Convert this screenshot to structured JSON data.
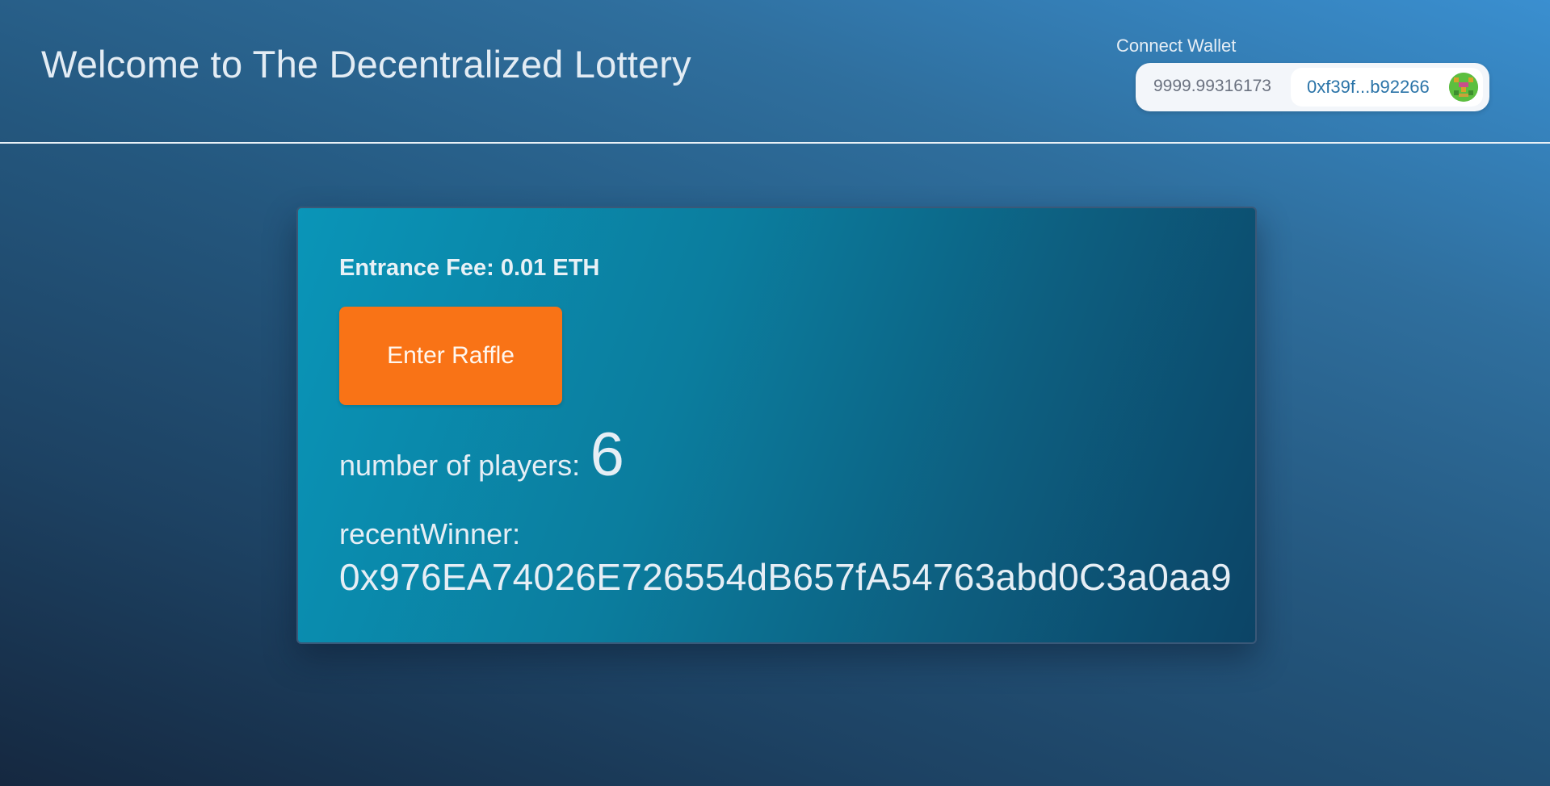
{
  "header": {
    "title": "Welcome to The Decentralized Lottery"
  },
  "wallet": {
    "connect_label": "Connect Wallet",
    "balance": "9999.99316173",
    "address": "0xf39f...b92266",
    "avatar_icon": "identicon-avatar"
  },
  "raffle": {
    "entrance_fee_label": "Entrance Fee:",
    "entrance_fee_value": "0.01 ETH",
    "enter_button_label": "Enter Raffle",
    "players_label": "number of players:",
    "players_count": "6",
    "recent_winner_label": "recentWinner:",
    "recent_winner_address": "0x976EA74026E726554dB657fA54763abd0C3a0aa9"
  },
  "colors": {
    "accent_button": "#f97316",
    "card_start": "#0a95b8",
    "card_end": "#0c4466",
    "address_text": "#2b74a8"
  }
}
